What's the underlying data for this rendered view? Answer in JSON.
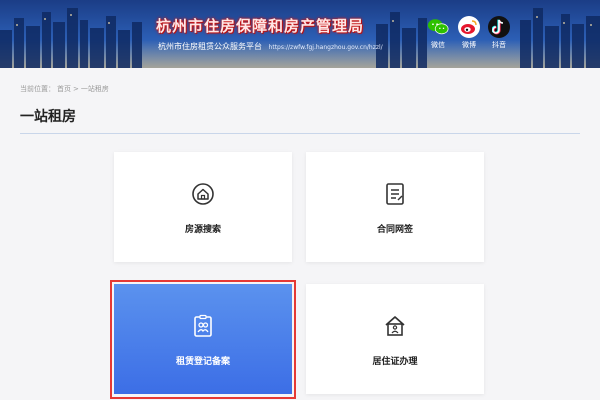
{
  "header": {
    "title": "杭州市住房保障和房产管理局",
    "subtitle": "杭州市住房租赁公众服务平台",
    "url": "https://zwfw.fgj.hangzhou.gov.cn/hzzl/",
    "social": [
      {
        "label": "微信",
        "icon": "wechat-icon",
        "color": "#2dc100"
      },
      {
        "label": "微博",
        "icon": "weibo-icon",
        "color": "#e6162d"
      },
      {
        "label": "抖音",
        "icon": "douyin-icon",
        "color": "#111111"
      }
    ]
  },
  "breadcrumb": {
    "prefix": "当前位置：",
    "home": "首页",
    "separator": ">",
    "current": "一站租房"
  },
  "page": {
    "title": "一站租房"
  },
  "cards": [
    {
      "label": "房源搜索",
      "icon": "house-search-icon"
    },
    {
      "label": "合同网签",
      "icon": "contract-icon"
    },
    {
      "label": "租赁登记备案",
      "icon": "registration-icon",
      "active": true
    },
    {
      "label": "居住证办理",
      "icon": "residence-permit-icon"
    }
  ],
  "colors": {
    "accent": "#3c6ee6",
    "highlight": "#e53935",
    "title_red": "#c81818"
  }
}
